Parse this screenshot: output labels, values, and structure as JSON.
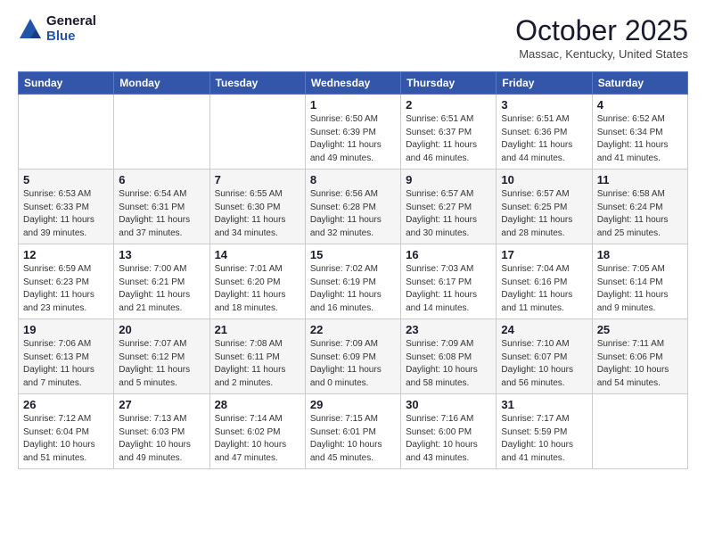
{
  "logo": {
    "general": "General",
    "blue": "Blue"
  },
  "header": {
    "month": "October 2025",
    "location": "Massac, Kentucky, United States"
  },
  "days_of_week": [
    "Sunday",
    "Monday",
    "Tuesday",
    "Wednesday",
    "Thursday",
    "Friday",
    "Saturday"
  ],
  "weeks": [
    [
      {
        "day": "",
        "info": ""
      },
      {
        "day": "",
        "info": ""
      },
      {
        "day": "",
        "info": ""
      },
      {
        "day": "1",
        "info": "Sunrise: 6:50 AM\nSunset: 6:39 PM\nDaylight: 11 hours\nand 49 minutes."
      },
      {
        "day": "2",
        "info": "Sunrise: 6:51 AM\nSunset: 6:37 PM\nDaylight: 11 hours\nand 46 minutes."
      },
      {
        "day": "3",
        "info": "Sunrise: 6:51 AM\nSunset: 6:36 PM\nDaylight: 11 hours\nand 44 minutes."
      },
      {
        "day": "4",
        "info": "Sunrise: 6:52 AM\nSunset: 6:34 PM\nDaylight: 11 hours\nand 41 minutes."
      }
    ],
    [
      {
        "day": "5",
        "info": "Sunrise: 6:53 AM\nSunset: 6:33 PM\nDaylight: 11 hours\nand 39 minutes."
      },
      {
        "day": "6",
        "info": "Sunrise: 6:54 AM\nSunset: 6:31 PM\nDaylight: 11 hours\nand 37 minutes."
      },
      {
        "day": "7",
        "info": "Sunrise: 6:55 AM\nSunset: 6:30 PM\nDaylight: 11 hours\nand 34 minutes."
      },
      {
        "day": "8",
        "info": "Sunrise: 6:56 AM\nSunset: 6:28 PM\nDaylight: 11 hours\nand 32 minutes."
      },
      {
        "day": "9",
        "info": "Sunrise: 6:57 AM\nSunset: 6:27 PM\nDaylight: 11 hours\nand 30 minutes."
      },
      {
        "day": "10",
        "info": "Sunrise: 6:57 AM\nSunset: 6:25 PM\nDaylight: 11 hours\nand 28 minutes."
      },
      {
        "day": "11",
        "info": "Sunrise: 6:58 AM\nSunset: 6:24 PM\nDaylight: 11 hours\nand 25 minutes."
      }
    ],
    [
      {
        "day": "12",
        "info": "Sunrise: 6:59 AM\nSunset: 6:23 PM\nDaylight: 11 hours\nand 23 minutes."
      },
      {
        "day": "13",
        "info": "Sunrise: 7:00 AM\nSunset: 6:21 PM\nDaylight: 11 hours\nand 21 minutes."
      },
      {
        "day": "14",
        "info": "Sunrise: 7:01 AM\nSunset: 6:20 PM\nDaylight: 11 hours\nand 18 minutes."
      },
      {
        "day": "15",
        "info": "Sunrise: 7:02 AM\nSunset: 6:19 PM\nDaylight: 11 hours\nand 16 minutes."
      },
      {
        "day": "16",
        "info": "Sunrise: 7:03 AM\nSunset: 6:17 PM\nDaylight: 11 hours\nand 14 minutes."
      },
      {
        "day": "17",
        "info": "Sunrise: 7:04 AM\nSunset: 6:16 PM\nDaylight: 11 hours\nand 11 minutes."
      },
      {
        "day": "18",
        "info": "Sunrise: 7:05 AM\nSunset: 6:14 PM\nDaylight: 11 hours\nand 9 minutes."
      }
    ],
    [
      {
        "day": "19",
        "info": "Sunrise: 7:06 AM\nSunset: 6:13 PM\nDaylight: 11 hours\nand 7 minutes."
      },
      {
        "day": "20",
        "info": "Sunrise: 7:07 AM\nSunset: 6:12 PM\nDaylight: 11 hours\nand 5 minutes."
      },
      {
        "day": "21",
        "info": "Sunrise: 7:08 AM\nSunset: 6:11 PM\nDaylight: 11 hours\nand 2 minutes."
      },
      {
        "day": "22",
        "info": "Sunrise: 7:09 AM\nSunset: 6:09 PM\nDaylight: 11 hours\nand 0 minutes."
      },
      {
        "day": "23",
        "info": "Sunrise: 7:09 AM\nSunset: 6:08 PM\nDaylight: 10 hours\nand 58 minutes."
      },
      {
        "day": "24",
        "info": "Sunrise: 7:10 AM\nSunset: 6:07 PM\nDaylight: 10 hours\nand 56 minutes."
      },
      {
        "day": "25",
        "info": "Sunrise: 7:11 AM\nSunset: 6:06 PM\nDaylight: 10 hours\nand 54 minutes."
      }
    ],
    [
      {
        "day": "26",
        "info": "Sunrise: 7:12 AM\nSunset: 6:04 PM\nDaylight: 10 hours\nand 51 minutes."
      },
      {
        "day": "27",
        "info": "Sunrise: 7:13 AM\nSunset: 6:03 PM\nDaylight: 10 hours\nand 49 minutes."
      },
      {
        "day": "28",
        "info": "Sunrise: 7:14 AM\nSunset: 6:02 PM\nDaylight: 10 hours\nand 47 minutes."
      },
      {
        "day": "29",
        "info": "Sunrise: 7:15 AM\nSunset: 6:01 PM\nDaylight: 10 hours\nand 45 minutes."
      },
      {
        "day": "30",
        "info": "Sunrise: 7:16 AM\nSunset: 6:00 PM\nDaylight: 10 hours\nand 43 minutes."
      },
      {
        "day": "31",
        "info": "Sunrise: 7:17 AM\nSunset: 5:59 PM\nDaylight: 10 hours\nand 41 minutes."
      },
      {
        "day": "",
        "info": ""
      }
    ]
  ]
}
